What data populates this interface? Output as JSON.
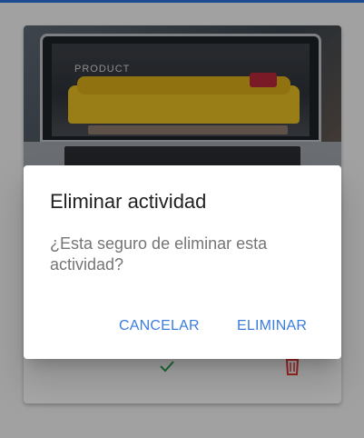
{
  "background_card": {
    "image_caption": "PRODUCT",
    "actions": {
      "confirm_icon": "check-icon",
      "delete_icon": "trash-icon"
    }
  },
  "dialog": {
    "title": "Eliminar actividad",
    "message": "¿Esta seguro de eliminar esta actividad?",
    "buttons": {
      "cancel_label": "CANCELAR",
      "delete_label": "ELIMINAR"
    }
  },
  "colors": {
    "accent_bar": "#2d6fd6",
    "button_text": "#3b7ddd",
    "check_icon": "#2e9e4f",
    "trash_icon": "#e53935"
  }
}
